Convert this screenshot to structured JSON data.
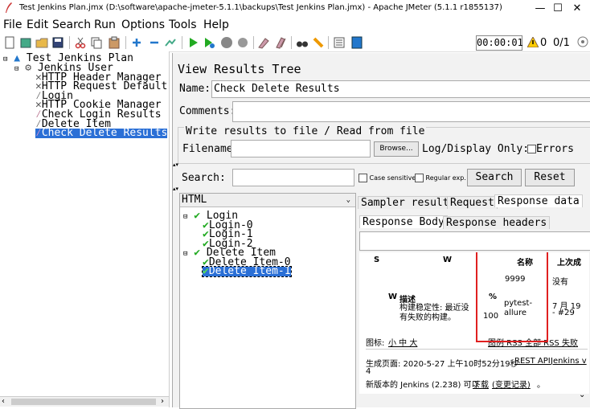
{
  "window": {
    "title": "Test Jenkins Plan.jmx (D:\\software\\apache-jmeter-5.1.1\\backups\\Test Jenkins Plan.jmx) - Apache JMeter (5.1.1 r1855137)",
    "controls": [
      "—",
      "☐",
      "✕"
    ]
  },
  "menu": [
    "File",
    "Edit",
    "Search",
    "Run",
    "Options",
    "Tools",
    "Help"
  ],
  "toolbar": {
    "timer": "00:00:01",
    "warning_count": "0",
    "threads": "0/1"
  },
  "tree": {
    "items": [
      {
        "label": "Test Jenkins Plan",
        "icon": "test-plan-icon"
      },
      {
        "label": "Jenkins User",
        "icon": "thread-group-icon"
      },
      {
        "label": "HTTP Header Manager",
        "icon": "config-element-icon"
      },
      {
        "label": "HTTP Request Default",
        "icon": "config-element-icon"
      },
      {
        "label": "Login",
        "icon": "sampler-icon"
      },
      {
        "label": "HTTP Cookie Manager",
        "icon": "config-element-icon"
      },
      {
        "label": "Check Login Results",
        "icon": "listener-icon"
      },
      {
        "label": "Delete Item",
        "icon": "sampler-icon"
      },
      {
        "label": "Check Delete Results",
        "icon": "listener-icon"
      }
    ]
  },
  "panel": {
    "title": "View Results Tree",
    "name_label": "Name:",
    "name_value": "Check Delete Results",
    "comments_label": "Comments:",
    "write_section": "Write results to file / Read from file",
    "filename_label": "Filename",
    "browse_label": "Browse...",
    "logdisplay_label": "Log/Display Only:",
    "errors_label": "Errors"
  },
  "search": {
    "label": "Search:",
    "case_sensitive": "Case sensitive",
    "regular_exp": "Regular exp.",
    "search_button": "Search",
    "reset_button": "Reset"
  },
  "results": {
    "renderer": "HTML",
    "samples": [
      {
        "label": "Login",
        "level": 0
      },
      {
        "label": "Login-0",
        "level": 1
      },
      {
        "label": "Login-1",
        "level": 1
      },
      {
        "label": "Login-2",
        "level": 1
      },
      {
        "label": "Delete Item",
        "level": 0
      },
      {
        "label": "Delete Item-0",
        "level": 1
      },
      {
        "label": "Delete Item-1",
        "level": 1
      }
    ],
    "tabs": [
      "Sampler result",
      "Request",
      "Response data"
    ],
    "subtabs": [
      "Response Body",
      "Response headers"
    ]
  },
  "html_view": {
    "col_s": "S",
    "col_w": "W",
    "col_name": "名称",
    "col_last": "上次成",
    "val_9999": "9999",
    "val_none": "没有",
    "w_label": "W",
    "desc_label": "描述",
    "pct_label": "%",
    "desc_text": "构建稳定性: 最近没有失败的构建。",
    "pct_value": "100",
    "job_name": "pytest-allure",
    "last_time": "7 月 19",
    "last_build": "- #29",
    "icon_label": "图标:",
    "icon_sizes": "小 中 大",
    "legend_links": "图例 RSS 全部 RSS 失败",
    "generated": "生成页面: 2020-5-27 上午10时52分19秒",
    "rest_api": "REST API",
    "jenkins_ver": "Jenkins v",
    "jenkins_ver_num": "4",
    "new_version": "新版本的 Jenkins (2.238) 可以",
    "download": "下载",
    "changelog": "(变更记录)",
    "tail": "。"
  }
}
